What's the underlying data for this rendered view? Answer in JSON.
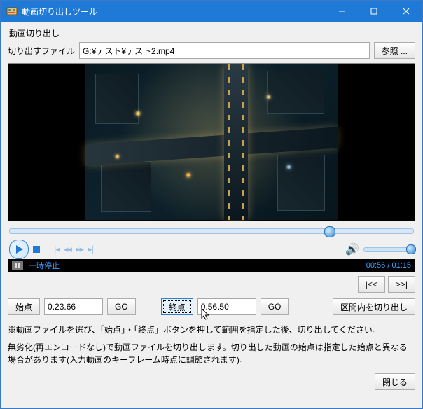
{
  "window": {
    "title": "動画切り出しツール"
  },
  "section_label": "動画切り出し",
  "file": {
    "label": "切り出すファイル",
    "value": "G:¥テスト¥テスト2.mp4",
    "browse": "参照 ..."
  },
  "seek": {
    "position_pct": 78
  },
  "status": {
    "state": "一時停止",
    "current": "00:56",
    "total": "01:15"
  },
  "nav": {
    "prev": "|<<",
    "next": ">>|"
  },
  "points": {
    "start_btn": "始点",
    "start_value": "0.23.66",
    "go1": "GO",
    "end_btn": "終点",
    "end_value": "0.56.50",
    "go2": "GO",
    "cut_btn": "区間内を切り出し"
  },
  "help": {
    "line1": "※動画ファイルを選び、「始点」・「終点」ボタンを押して範囲を指定した後、切り出してください。",
    "line2": "無劣化(再エンコードなし)で動画ファイルを切り出します。切り出した動画の始点は指定した始点と異なる場合があります(入力動画のキーフレーム時点に調節されます)。"
  },
  "close_btn": "閉じる"
}
